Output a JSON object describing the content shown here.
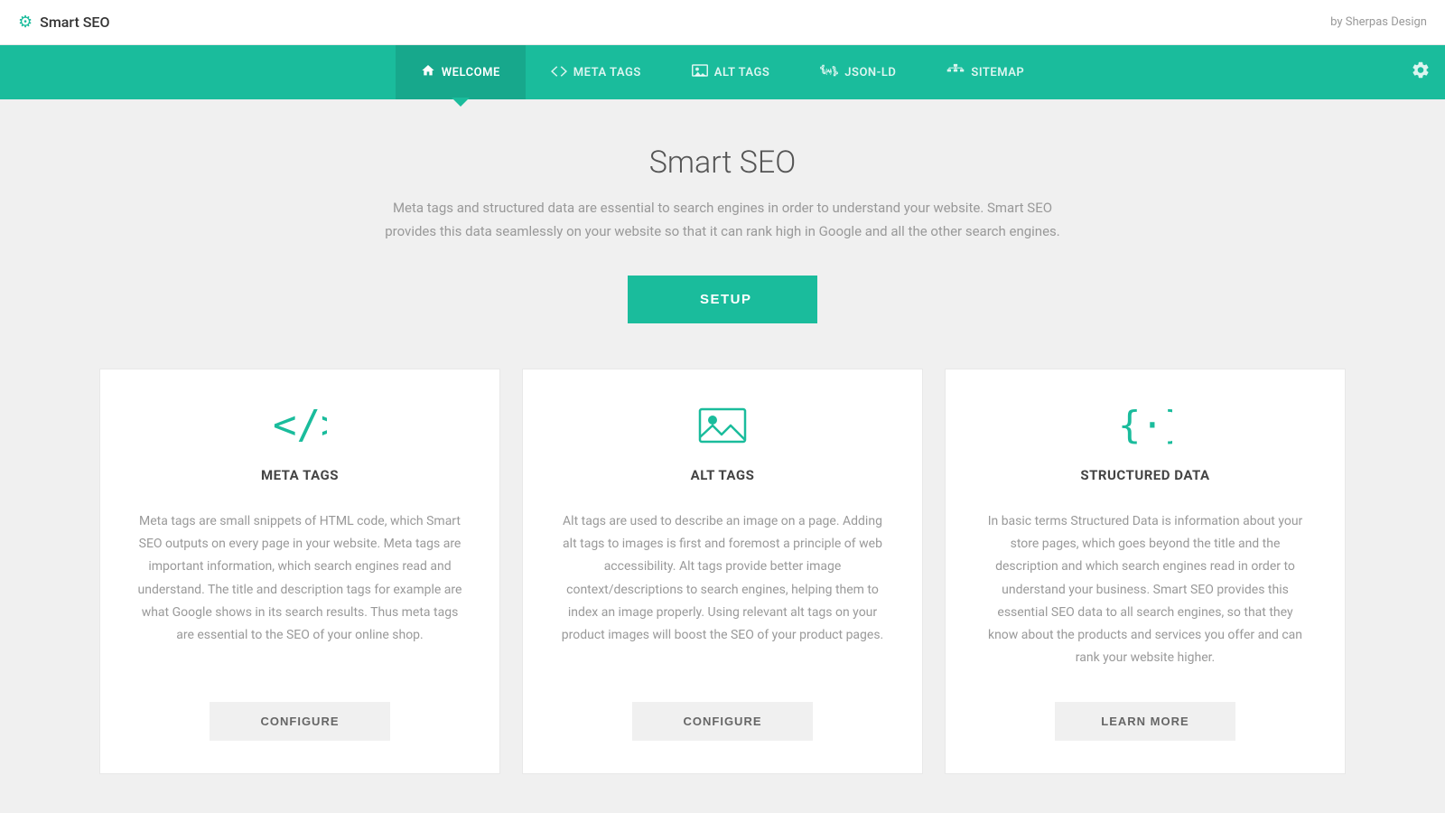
{
  "app": {
    "title": "Smart SEO",
    "credit": "by Sherpas Design"
  },
  "nav": {
    "items": [
      {
        "id": "welcome",
        "label": "WELCOME",
        "icon": "home",
        "active": true
      },
      {
        "id": "meta-tags",
        "label": "META TAGS",
        "icon": "code",
        "active": false
      },
      {
        "id": "alt-tags",
        "label": "ALT TAGS",
        "icon": "image",
        "active": false
      },
      {
        "id": "json-ld",
        "label": "JSON-LD",
        "icon": "braces",
        "active": false
      },
      {
        "id": "sitemap",
        "label": "SITEMAP",
        "icon": "sitemap",
        "active": false
      }
    ],
    "settings_icon": "⚙"
  },
  "main": {
    "title": "Smart SEO",
    "subtitle": "Meta tags and structured data are essential to search engines in order to understand your website. Smart SEO provides this data seamlessly on your website so that it can rank high in Google and all the other search engines.",
    "setup_button": "SETUP"
  },
  "cards": [
    {
      "id": "meta-tags",
      "title": "META TAGS",
      "description": "Meta tags are small snippets of HTML code, which Smart SEO outputs on every page in your website. Meta tags are important information, which search engines read and understand. The title and description tags for example are what Google shows in its search results. Thus meta tags are essential to the SEO of your online shop.",
      "button": "CONFIGURE"
    },
    {
      "id": "alt-tags",
      "title": "ALT TAGS",
      "description": "Alt tags are used to describe an image on a page. Adding alt tags to images is first and foremost a principle of web accessibility. Alt tags provide better image context/descriptions to search engines, helping them to index an image properly. Using relevant alt tags on your product images will boost the SEO of your product pages.",
      "button": "CONFIGURE"
    },
    {
      "id": "structured-data",
      "title": "STRUCTURED DATA",
      "description": "In basic terms Structured Data is information about your store pages, which goes beyond the title and the description and which search engines read in order to understand your business. Smart SEO provides this essential SEO data to all search engines, so that they know about the products and services you offer and can rank your website higher.",
      "button": "LEARN MORE"
    }
  ],
  "colors": {
    "teal": "#1abc9c",
    "dark_text": "#555",
    "light_text": "#999"
  }
}
